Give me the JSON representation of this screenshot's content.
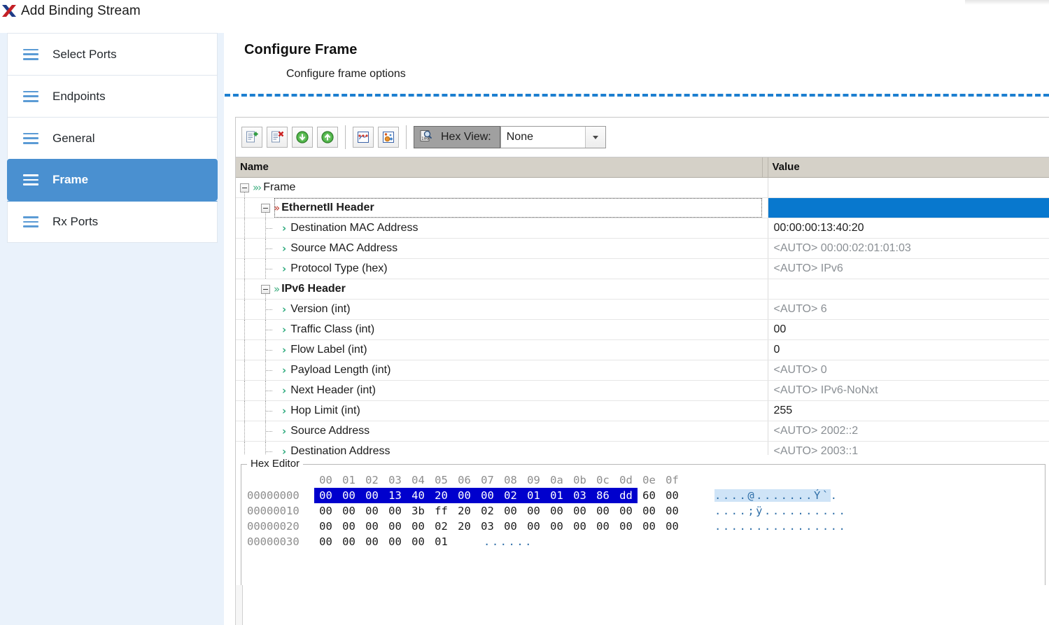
{
  "window": {
    "title": "Add Binding Stream",
    "app_icon": "xena-x-icon"
  },
  "sidebar": {
    "items": [
      {
        "label": "Select Ports",
        "icon": "list-menu-icon",
        "selected": false
      },
      {
        "label": "Endpoints",
        "icon": "list-menu-icon",
        "selected": false
      },
      {
        "label": "General",
        "icon": "list-menu-icon",
        "selected": false
      },
      {
        "label": "Frame",
        "icon": "list-menu-icon",
        "selected": true
      },
      {
        "label": "Rx Ports",
        "icon": "list-menu-icon",
        "selected": false
      }
    ]
  },
  "page": {
    "title": "Configure Frame",
    "subtitle": "Configure frame options",
    "accent_color": "#1d7fd0"
  },
  "toolbar": {
    "buttons": [
      {
        "name": "add-protocol-button",
        "icon": "document-add-icon",
        "tooltip": "Add"
      },
      {
        "name": "delete-protocol-button",
        "icon": "document-delete-icon",
        "tooltip": "Delete"
      },
      {
        "name": "move-down-button",
        "icon": "arrow-down-circle-icon",
        "tooltip": "Move Down"
      },
      {
        "name": "move-up-button",
        "icon": "arrow-up-circle-icon",
        "tooltip": "Move Up"
      },
      {
        "name": "modifiers-button",
        "icon": "network-graph-icon",
        "tooltip": "Modifiers"
      },
      {
        "name": "payload-button",
        "icon": "bubbles-icon",
        "tooltip": "Payload"
      }
    ],
    "hex_view": {
      "icon": "hex-magnifier-icon",
      "label": "Hex View:",
      "pressed": true,
      "selected_option": "None",
      "options": [
        "None"
      ]
    }
  },
  "tree": {
    "columns": [
      "Name",
      "Value"
    ],
    "rows": [
      {
        "label": "Frame",
        "value": "",
        "depth": 0,
        "bold": false,
        "expander": "minus",
        "chevron": "triple-green",
        "auto": false,
        "selected": false
      },
      {
        "label": "EthernetII Header",
        "value": "",
        "depth": 1,
        "bold": true,
        "expander": "minus",
        "chevron": "double-red",
        "auto": false,
        "selected": true
      },
      {
        "label": "Destination MAC Address",
        "value": "00:00:00:13:40:20",
        "depth": 2,
        "bold": false,
        "expander": "none",
        "chevron": "single-green",
        "auto": false,
        "selected": false
      },
      {
        "label": "Source MAC Address",
        "value": "<AUTO> 00:00:02:01:01:03",
        "depth": 2,
        "bold": false,
        "expander": "none",
        "chevron": "single-green",
        "auto": true,
        "selected": false
      },
      {
        "label": "Protocol Type (hex)",
        "value": "<AUTO> IPv6",
        "depth": 2,
        "bold": false,
        "expander": "none",
        "chevron": "single-green",
        "auto": true,
        "selected": false
      },
      {
        "label": "IPv6 Header",
        "value": "",
        "depth": 1,
        "bold": true,
        "expander": "minus",
        "chevron": "double-green",
        "auto": false,
        "selected": false
      },
      {
        "label": "Version  (int)",
        "value": "<AUTO> 6",
        "depth": 2,
        "bold": false,
        "expander": "none",
        "chevron": "single-green",
        "auto": true,
        "selected": false
      },
      {
        "label": "Traffic Class (int)",
        "value": "00",
        "depth": 2,
        "bold": false,
        "expander": "none",
        "chevron": "single-green",
        "auto": false,
        "selected": false
      },
      {
        "label": "Flow Label (int)",
        "value": "0",
        "depth": 2,
        "bold": false,
        "expander": "none",
        "chevron": "single-green",
        "auto": false,
        "selected": false
      },
      {
        "label": "Payload Length (int)",
        "value": "<AUTO> 0",
        "depth": 2,
        "bold": false,
        "expander": "none",
        "chevron": "single-green",
        "auto": true,
        "selected": false
      },
      {
        "label": "Next Header (int)",
        "value": "<AUTO> IPv6-NoNxt",
        "depth": 2,
        "bold": false,
        "expander": "none",
        "chevron": "single-green",
        "auto": true,
        "selected": false
      },
      {
        "label": "Hop Limit (int)",
        "value": "255",
        "depth": 2,
        "bold": false,
        "expander": "none",
        "chevron": "single-green",
        "auto": false,
        "selected": false
      },
      {
        "label": "Source Address",
        "value": "<AUTO> 2002::2",
        "depth": 2,
        "bold": false,
        "expander": "none",
        "chevron": "single-green",
        "auto": true,
        "selected": false
      },
      {
        "label": "Destination Address",
        "value": "<AUTO> 2003::1",
        "depth": 2,
        "bold": false,
        "expander": "none",
        "chevron": "single-green",
        "auto": true,
        "selected": false
      }
    ]
  },
  "hex_editor": {
    "legend": "Hex Editor",
    "column_headers": [
      "00",
      "01",
      "02",
      "03",
      "04",
      "05",
      "06",
      "07",
      "08",
      "09",
      "0a",
      "0b",
      "0c",
      "0d",
      "0e",
      "0f"
    ],
    "selection_color": "#0000cd",
    "lines": [
      {
        "offset": "00000000",
        "bytes": [
          "00",
          "00",
          "00",
          "13",
          "40",
          "20",
          "00",
          "00",
          "02",
          "01",
          "01",
          "03",
          "86",
          "dd",
          "60",
          "00"
        ],
        "selected_count": 14,
        "ascii": "....@.......Ý`.",
        "ascii_selected_count": 14
      },
      {
        "offset": "00000010",
        "bytes": [
          "00",
          "00",
          "00",
          "00",
          "3b",
          "ff",
          "20",
          "02",
          "00",
          "00",
          "00",
          "00",
          "00",
          "00",
          "00",
          "00"
        ],
        "selected_count": 0,
        "ascii": "....;ÿ..........",
        "ascii_selected_count": 0
      },
      {
        "offset": "00000020",
        "bytes": [
          "00",
          "00",
          "00",
          "00",
          "00",
          "02",
          "20",
          "03",
          "00",
          "00",
          "00",
          "00",
          "00",
          "00",
          "00",
          "00"
        ],
        "selected_count": 0,
        "ascii": "................",
        "ascii_selected_count": 0
      },
      {
        "offset": "00000030",
        "bytes": [
          "00",
          "00",
          "00",
          "00",
          "00",
          "01"
        ],
        "selected_count": 0,
        "ascii": "......",
        "ascii_selected_count": 0
      }
    ]
  }
}
